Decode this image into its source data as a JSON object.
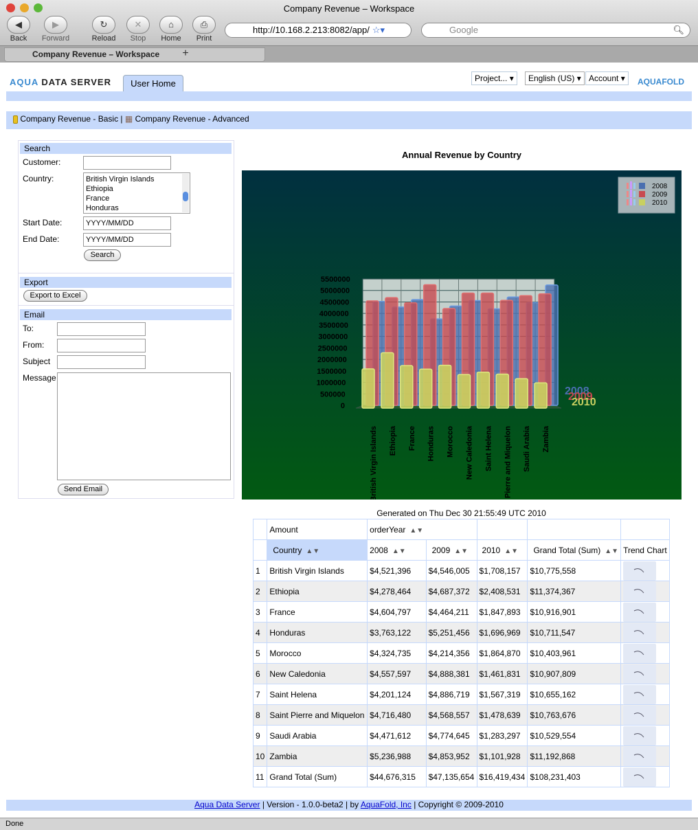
{
  "window": {
    "title": "Company Revenue – Workspace",
    "status": "Done"
  },
  "toolbar": {
    "back": "Back",
    "forward": "Forward",
    "reload": "Reload",
    "stop": "Stop",
    "home": "Home",
    "print": "Print",
    "url": "http://10.168.2.213:8082/app/",
    "search_placeholder": "Google"
  },
  "tab": {
    "label": "Company Revenue – Workspace",
    "new_tab": "+"
  },
  "header": {
    "logo": "AQUA DATA SERVER",
    "home_tab": "User Home",
    "project": "Project...",
    "language": "English (US)",
    "account": "Account",
    "brand": "AQUAFOLD"
  },
  "breadcrumb": {
    "basic": "Company Revenue - Basic",
    "sep": "|",
    "advanced": "Company Revenue - Advanced"
  },
  "search": {
    "title": "Search",
    "customer_label": "Customer:",
    "customer_value": "",
    "country_label": "Country:",
    "countries": [
      "British Virgin Islands",
      "Ethiopia",
      "France",
      "Honduras"
    ],
    "start_label": "Start Date:",
    "start_value": "YYYY/MM/DD",
    "end_label": "End Date:",
    "end_value": "YYYY/MM/DD",
    "button": "Search"
  },
  "export": {
    "title": "Export",
    "button": "Export to Excel"
  },
  "email": {
    "title": "Email",
    "to": "To:",
    "from": "From:",
    "subject": "Subject",
    "message": "Message",
    "button": "Send Email"
  },
  "chart_data": {
    "type": "bar",
    "title": "Annual Revenue by Country",
    "style": "3d-grouped",
    "categories": [
      "British Virgin Islands",
      "Ethiopia",
      "France",
      "Honduras",
      "Morocco",
      "New Caledonia",
      "Saint Helena",
      "Saint Pierre and Miquelon",
      "Saudi Arabia",
      "Zambia"
    ],
    "series": [
      {
        "name": "2008",
        "color": "#4a6fb0",
        "values": [
          4521396,
          4278464,
          4604797,
          3763122,
          4324735,
          4557597,
          4201124,
          4716480,
          4471612,
          5236988
        ]
      },
      {
        "name": "2009",
        "color": "#c84a50",
        "values": [
          4546005,
          4687372,
          4464211,
          5251456,
          4214356,
          4888381,
          4886719,
          4568557,
          4774645,
          4853952
        ]
      },
      {
        "name": "2010",
        "color": "#c8d060",
        "values": [
          1708157,
          2408531,
          1847893,
          1696969,
          1864870,
          1461831,
          1567319,
          1478639,
          1283297,
          1101928
        ]
      }
    ],
    "yticks": [
      "0",
      "500000",
      "1000000",
      "1500000",
      "2000000",
      "2500000",
      "3000000",
      "3500000",
      "4000000",
      "4500000",
      "5000000",
      "5500000"
    ],
    "ylim": [
      0,
      5500000
    ],
    "legend": "top-right",
    "grid": true
  },
  "generated": "Generated on Thu Dec 30 21:55:49 UTC 2010",
  "table": {
    "measure": "Amount",
    "col_field": "orderYear",
    "row_field": "Country",
    "headers": [
      "2008",
      "2009",
      "2010",
      "Grand Total (Sum)",
      "Trend Chart"
    ],
    "rows": [
      [
        "1",
        "British Virgin Islands",
        "$4,521,396",
        "$4,546,005",
        "$1,708,157",
        "$10,775,558"
      ],
      [
        "2",
        "Ethiopia",
        "$4,278,464",
        "$4,687,372",
        "$2,408,531",
        "$11,374,367"
      ],
      [
        "3",
        "France",
        "$4,604,797",
        "$4,464,211",
        "$1,847,893",
        "$10,916,901"
      ],
      [
        "4",
        "Honduras",
        "$3,763,122",
        "$5,251,456",
        "$1,696,969",
        "$10,711,547"
      ],
      [
        "5",
        "Morocco",
        "$4,324,735",
        "$4,214,356",
        "$1,864,870",
        "$10,403,961"
      ],
      [
        "6",
        "New Caledonia",
        "$4,557,597",
        "$4,888,381",
        "$1,461,831",
        "$10,907,809"
      ],
      [
        "7",
        "Saint Helena",
        "$4,201,124",
        "$4,886,719",
        "$1,567,319",
        "$10,655,162"
      ],
      [
        "8",
        "Saint Pierre and Miquelon",
        "$4,716,480",
        "$4,568,557",
        "$1,478,639",
        "$10,763,676"
      ],
      [
        "9",
        "Saudi Arabia",
        "$4,471,612",
        "$4,774,645",
        "$1,283,297",
        "$10,529,554"
      ],
      [
        "10",
        "Zambia",
        "$5,236,988",
        "$4,853,952",
        "$1,101,928",
        "$11,192,868"
      ],
      [
        "11",
        "Grand Total (Sum)",
        "$44,676,315",
        "$47,135,654",
        "$16,419,434",
        "$108,231,403"
      ]
    ]
  },
  "footer": {
    "link1": "Aqua Data Server",
    "version": " | Version - 1.0.0-beta2 | by ",
    "link2": "AquaFold, Inc",
    "copyright": " | Copyright © 2009-2010"
  }
}
